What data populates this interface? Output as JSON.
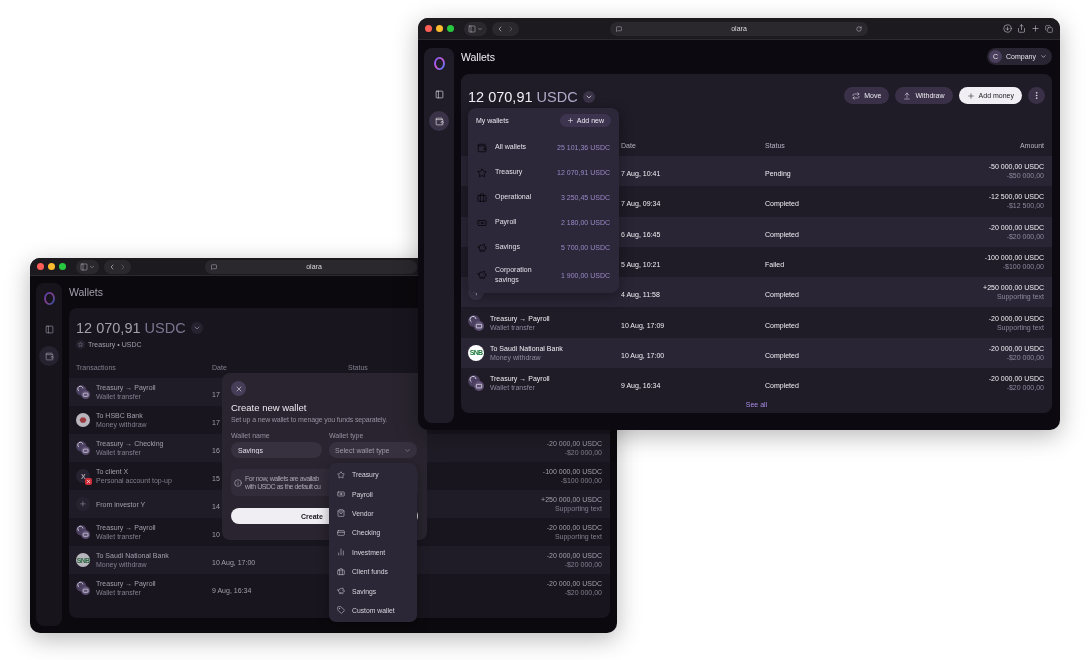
{
  "back_window": {
    "url": "olara",
    "page_title": "Wallets",
    "sidebar": [
      {
        "kind": "panel",
        "selected": false
      },
      {
        "kind": "wallet",
        "selected": true
      }
    ],
    "balance": {
      "amount": "12 070,91",
      "currency": "USDC"
    },
    "wallet_line": "Treasury • USDC",
    "columns": [
      "Transactions",
      "Date",
      "Status"
    ],
    "rows": [
      {
        "kind": "transfer",
        "failed": false,
        "title": "Treasury → Payroll",
        "subtitle": "Wallet transfer",
        "date": "17"
      },
      {
        "kind": "bank",
        "failed": false,
        "title": "To HSBC Bank",
        "subtitle": "Money withdraw",
        "date": "17"
      },
      {
        "kind": "transfer",
        "failed": false,
        "title": "Treasury → Checking",
        "subtitle": "Wallet transfer",
        "date": "16",
        "amount": "-20 000,00 USDC",
        "amount_sub": "-$20 000,00"
      },
      {
        "kind": "person",
        "initial": "X",
        "failed": true,
        "title": "To client X",
        "subtitle": "Personal account top-up",
        "date": "15",
        "amount": "-100 000,00 USDC",
        "amount_sub": "-$100 000,00"
      },
      {
        "kind": "deposit",
        "failed": false,
        "title": "From investor Y",
        "date": "14",
        "amount": "+250 000,00 USDC",
        "amount_sub": "Supporting text"
      },
      {
        "kind": "transfer",
        "failed": false,
        "title": "Treasury → Payroll",
        "subtitle": "Wallet transfer",
        "date": "10",
        "amount": "-20 000,00 USDC",
        "amount_sub": "Supporting text"
      },
      {
        "kind": "logo",
        "logo_text": "SNB",
        "failed": false,
        "title": "To Saudi National Bank",
        "subtitle": "Money withdraw",
        "date": "10 Aug, 17:00",
        "amount": "-20 000,00 USDC",
        "amount_sub": "-$20 000,00"
      },
      {
        "kind": "transfer",
        "failed": false,
        "title": "Treasury → Payroll",
        "subtitle": "Wallet transfer",
        "date": "9 Aug, 16:34",
        "amount": "-20 000,00 USDC",
        "amount_sub": "-$20 000,00"
      }
    ],
    "modal": {
      "title": "Create new wallet",
      "subtitle": "Set up a new wallet to menage you funds separately.",
      "name_label": "Wallet name",
      "name_value": "Savings",
      "type_label": "Wallet type",
      "type_placeholder": "Select wallet type",
      "info_lines": [
        "For now, wallets are availab",
        "with USDC as the default cu"
      ],
      "submit": "Create"
    },
    "type_menu": [
      {
        "kind": "treasury",
        "label": "Treasury"
      },
      {
        "kind": "payroll",
        "label": "Payroll"
      },
      {
        "kind": "vendor",
        "label": "Vendor"
      },
      {
        "kind": "checking",
        "label": "Checking"
      },
      {
        "kind": "investment",
        "label": "Investment"
      },
      {
        "kind": "client_funds",
        "label": "Client funds"
      },
      {
        "kind": "savings",
        "label": "Savings"
      },
      {
        "kind": "custom",
        "label": "Custom wallet"
      }
    ]
  },
  "front_window": {
    "url": "olara",
    "page_title": "Wallets",
    "sidebar": [
      {
        "kind": "panel",
        "selected": false
      },
      {
        "kind": "wallet",
        "selected": true
      }
    ],
    "account": {
      "initial": "C",
      "label": "Company"
    },
    "balance": {
      "amount": "12 070,91",
      "currency": "USDC"
    },
    "actions": [
      {
        "kind": "move",
        "label": "Move",
        "primary": false
      },
      {
        "kind": "withdraw",
        "label": "Withdraw",
        "primary": false
      },
      {
        "kind": "add",
        "label": "Add money",
        "primary": true
      }
    ],
    "columns": [
      "Date",
      "Status",
      "Amount"
    ],
    "rows": [
      {
        "date": "7 Aug, 10:41",
        "status": "Pending",
        "amount": "-50 000,00 USDC",
        "amount_sub": "-$50 000,00"
      },
      {
        "date": "7 Aug, 09:34",
        "status": "Completed",
        "amount": "-12 500,00 USDC",
        "amount_sub": "-$12 500,00"
      },
      {
        "date": "6 Aug, 16:45",
        "status": "Completed",
        "amount": "-20 000,00 USDC",
        "amount_sub": "-$20 000,00"
      },
      {
        "date": "5 Aug, 10:21",
        "status": "Failed",
        "amount": "-100 000,00 USDC",
        "amount_sub": "-$100 000,00"
      },
      {
        "kind": "deposit",
        "date": "4 Aug, 11:58",
        "status": "Completed",
        "amount": "+250 000,00 USDC",
        "amount_sub": "Supporting text"
      },
      {
        "kind": "transfer",
        "title": "Treasury → Payroll",
        "subtitle": "Wallet transfer",
        "date": "10 Aug, 17:09",
        "status": "Completed",
        "amount": "-20 000,00 USDC",
        "amount_sub": "Supporting text"
      },
      {
        "kind": "logo",
        "logo_text": "SNB",
        "title": "To Saudi National Bank",
        "subtitle": "Money withdraw",
        "date": "10 Aug, 17:00",
        "status": "Completed",
        "amount": "-20 000,00 USDC",
        "amount_sub": "-$20 000,00"
      },
      {
        "kind": "transfer",
        "title": "Treasury → Payroll",
        "subtitle": "Wallet transfer",
        "date": "9 Aug, 16:34",
        "status": "Completed",
        "amount": "-20 000,00 USDC",
        "amount_sub": "-$20 000,00"
      }
    ],
    "see_all": "See all",
    "wallets_menu": {
      "title": "My wallets",
      "add_label": "Add new",
      "items": [
        {
          "kind": "all",
          "name": "All wallets",
          "amount": "25 101,36 USDC"
        },
        {
          "kind": "treasury",
          "name": "Treasury",
          "amount": "12 070,91 USDC"
        },
        {
          "kind": "operational",
          "name": "Operational",
          "amount": "3 250,45 USDC"
        },
        {
          "kind": "payroll",
          "name": "Payroll",
          "amount": "2 180,00 USDC"
        },
        {
          "kind": "savings",
          "name": "Savings",
          "amount": "5 700,00 USDC"
        },
        {
          "kind": "savings",
          "name": "Corporation savings",
          "amount": "1 900,00 USDC"
        }
      ]
    }
  }
}
